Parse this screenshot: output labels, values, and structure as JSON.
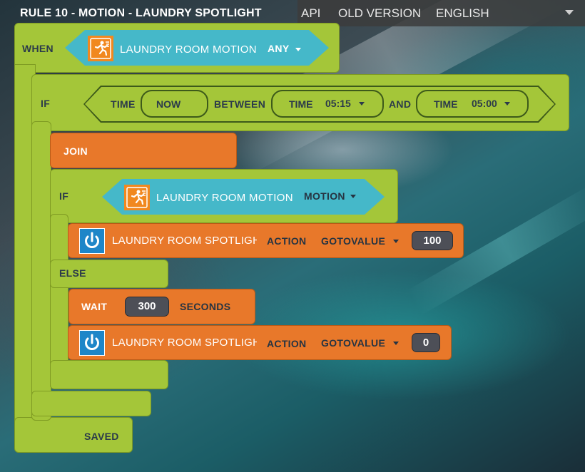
{
  "header": {
    "rule_title": "RULE 10 - MOTION - LAUNDRY SPOTLIGHT",
    "nav": {
      "api": "API",
      "old_version": "OLD VERSION",
      "language": "ENGLISH"
    }
  },
  "when_block": {
    "label": "WHEN",
    "device": "LAUNDRY ROOM MOTION",
    "state": "ANY"
  },
  "if_block": {
    "label": "IF",
    "time1_label": "TIME",
    "time1_value": "NOW",
    "between_label": "BETWEEN",
    "time2_label": "TIME",
    "time2_value": "05:15",
    "and_label": "AND",
    "time3_label": "TIME",
    "time3_value": "05:00"
  },
  "join_block": {
    "label": "JOIN"
  },
  "inner_if": {
    "label": "IF",
    "device": "LAUNDRY ROOM MOTION",
    "state": "MOTION"
  },
  "action1": {
    "device": "LAUNDRY ROOM SPOTLIGHT",
    "action_label": "ACTION",
    "action": "GOTOVALUE",
    "value": "100"
  },
  "else_block": {
    "label": "ELSE"
  },
  "wait_block": {
    "label": "WAIT",
    "value": "300",
    "unit": "SECONDS"
  },
  "action2": {
    "device": "LAUNDRY ROOM SPOTLIGHT",
    "action_label": "ACTION",
    "action": "GOTOVALUE",
    "value": "0"
  },
  "footer": {
    "status": "SAVED"
  },
  "icons": {
    "motion": "running-person-icon",
    "power": "power-icon"
  },
  "colors": {
    "block_green": "#a4c639",
    "block_orange": "#e8782a",
    "block_teal": "#45b8c9",
    "power_blue": "#1e86c8",
    "motion_orange": "#f1881f"
  }
}
